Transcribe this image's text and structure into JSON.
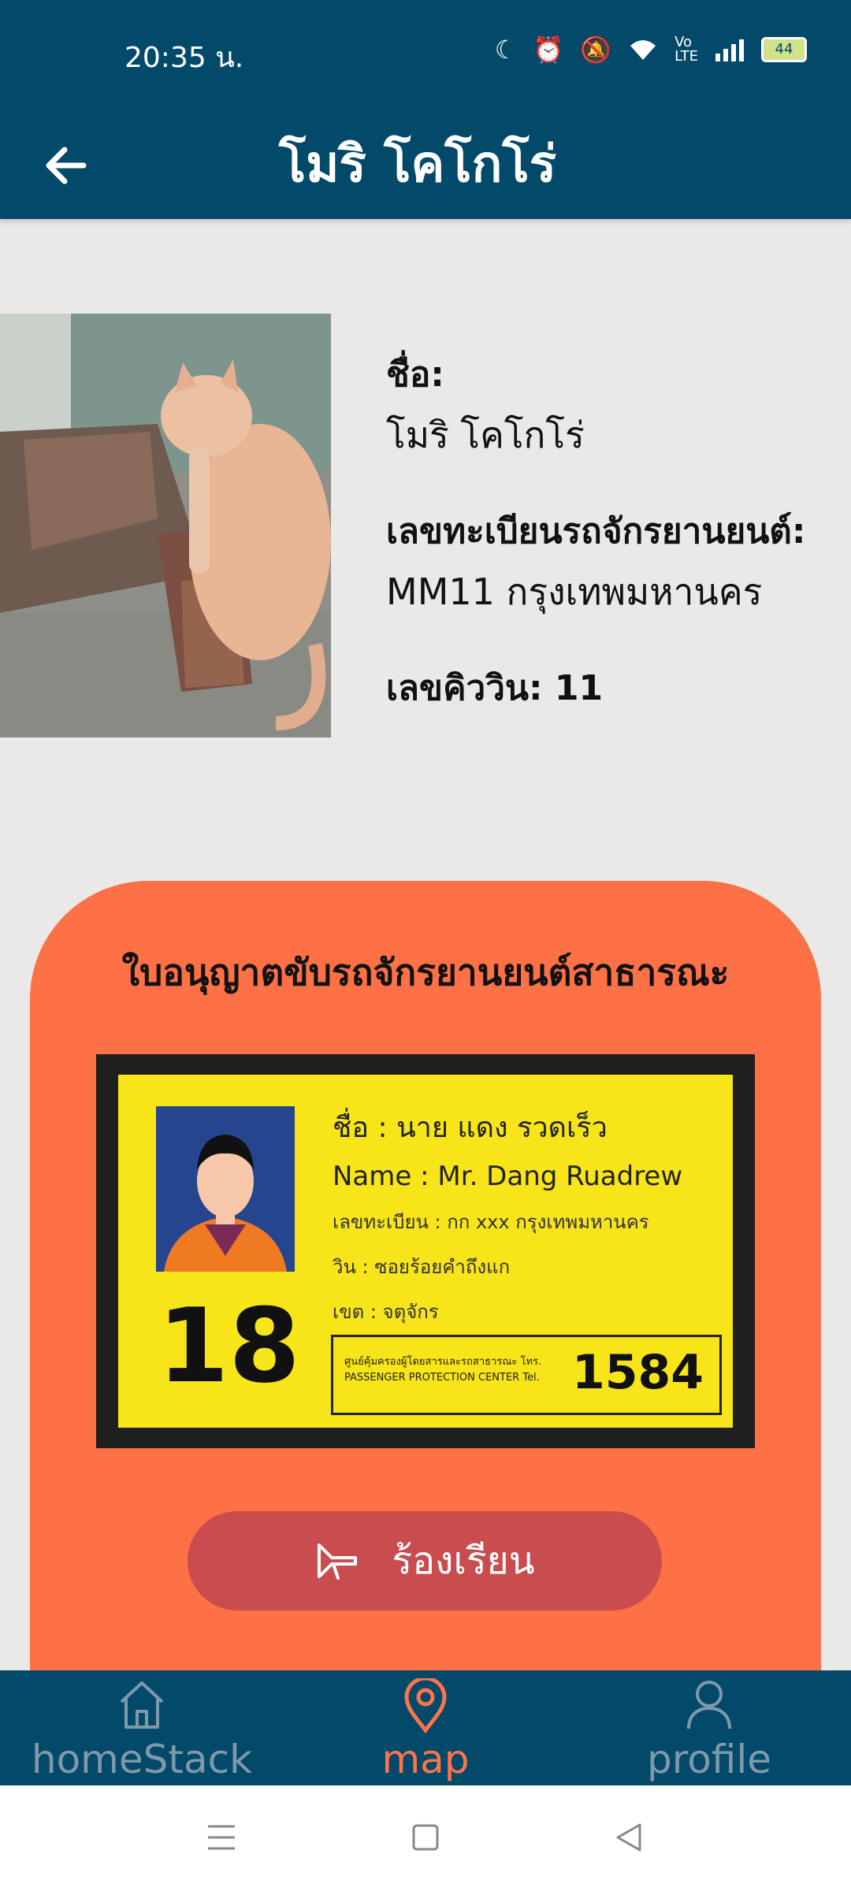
{
  "status_bar": {
    "time": "20:35 น.",
    "battery": "44"
  },
  "app_bar": {
    "title": "โมริ โคโกโร่"
  },
  "profile": {
    "name_label": "ชื่อ:",
    "name_value": "โมริ โคโกโร่",
    "plate_label": "เลขทะเบียนรถจักรยานยนต์:",
    "plate_value": "MM11 กรุงเทพมหานคร",
    "queue_label": "เลขคิววิน: 11"
  },
  "license_card": {
    "title": "ใบอนุญาตขับรถจักรยานยนต์สาธารณะ",
    "line_name_th": "ชื่อ : นาย แดง รวดเร็ว",
    "line_name_en": "Name : Mr. Dang Ruadrew",
    "line_plate": "เลขทะเบียน : กก xxx กรุงเทพมหานคร",
    "line_win": "วิน : ซอยร้อยคำถึงแก",
    "line_zone": "เขต : จตุจักร",
    "number": "18",
    "center_small_th": "ศูนย์คุ้มครองผู้โดยสารและรถสาธารณะ โทร.",
    "center_small_en": "PASSENGER PROTECTION CENTER Tel.",
    "hotline": "1584"
  },
  "complain_button": {
    "label": "ร้องเรียน"
  },
  "bottom_nav": {
    "items": [
      {
        "label": "homeStack",
        "icon": "home-icon",
        "active": false
      },
      {
        "label": "map",
        "icon": "map-pin-icon",
        "active": true
      },
      {
        "label": "profile",
        "icon": "person-icon",
        "active": false
      }
    ],
    "active_color": "#ff7448",
    "inactive_color": "#7f99ab"
  },
  "colors": {
    "primary": "#03496a",
    "card": "#fe7045",
    "button": "#c94c4f",
    "background": "#ebe9e8"
  }
}
